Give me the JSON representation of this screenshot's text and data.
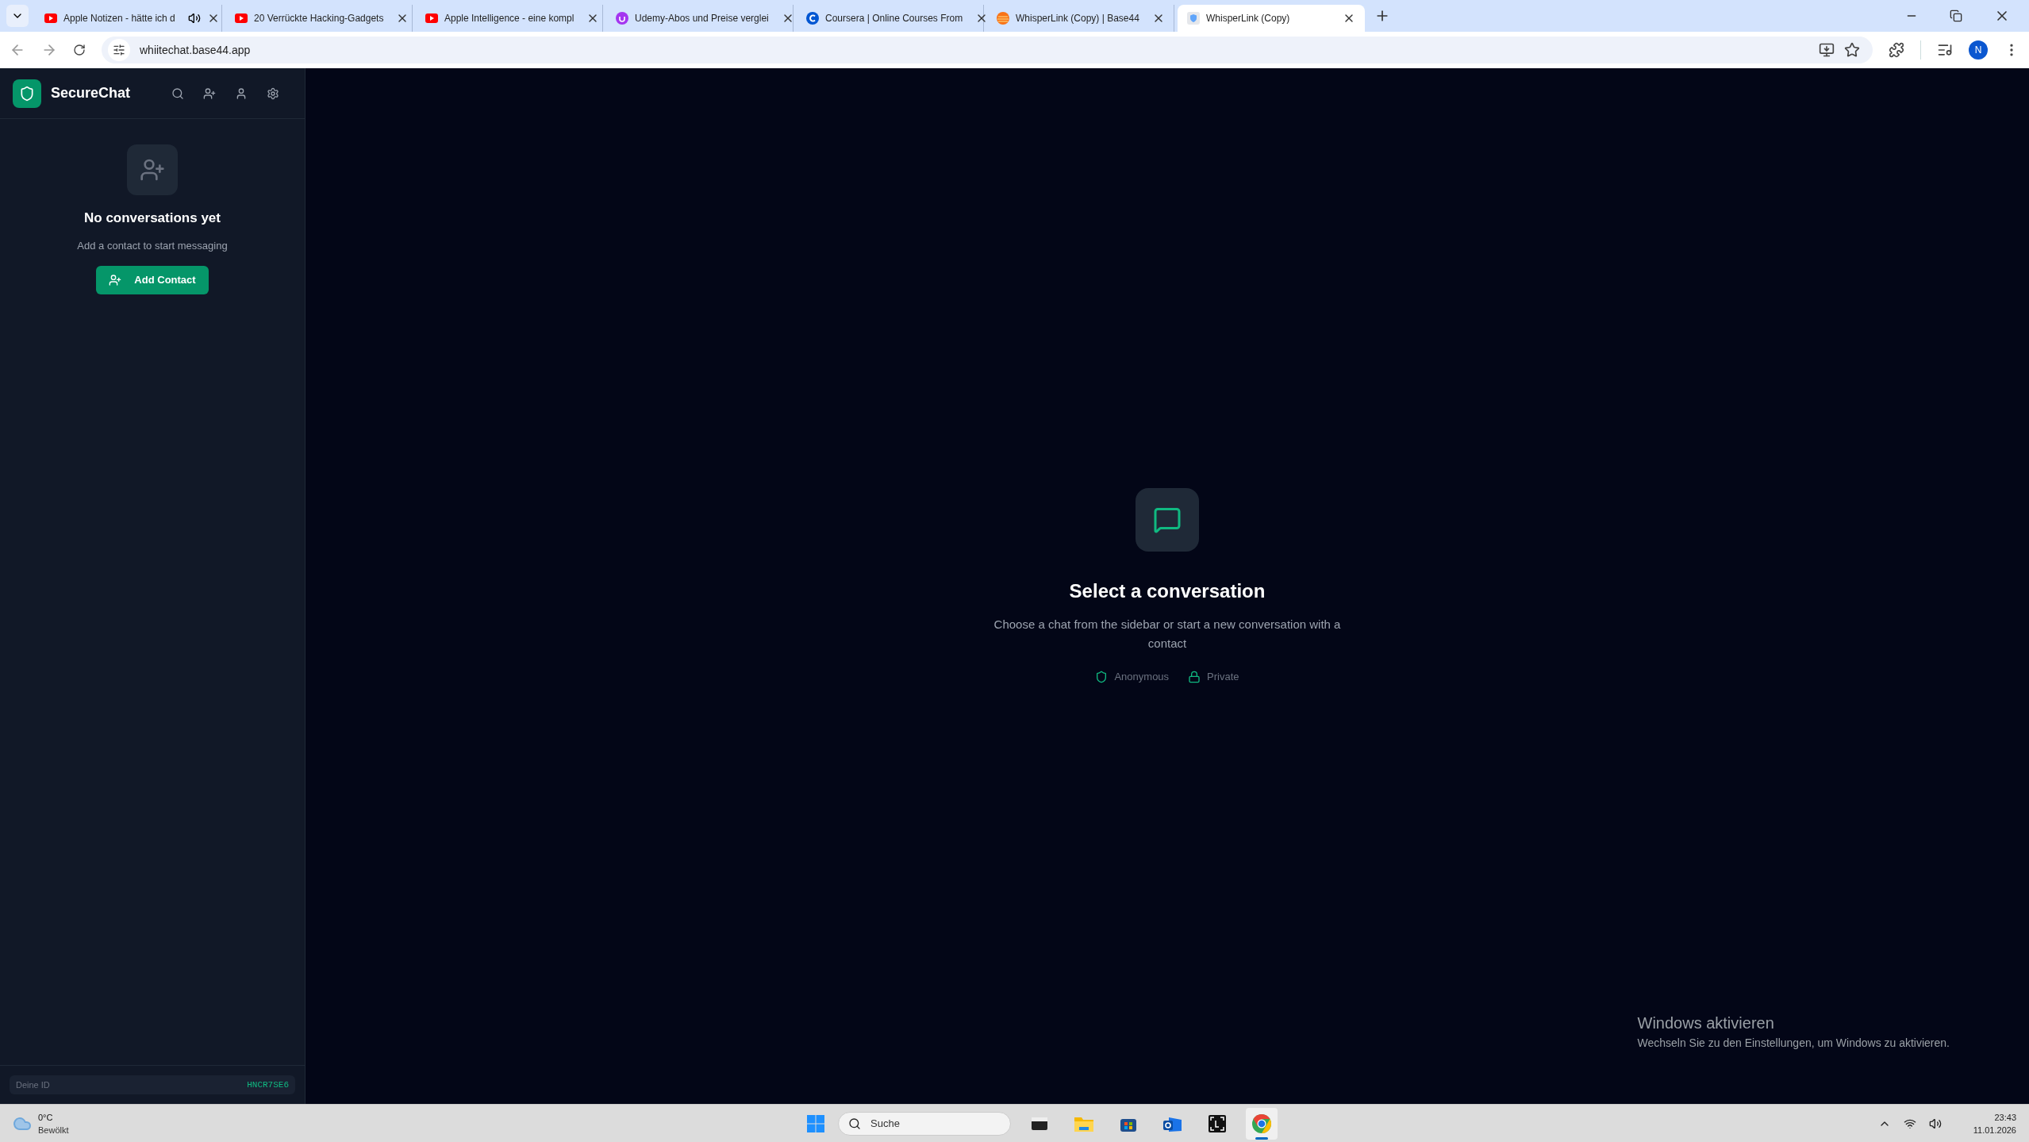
{
  "browser": {
    "tabs": [
      {
        "title": "Apple Notizen - hätte ich d",
        "kind": "youtube",
        "audio": true,
        "selected": false
      },
      {
        "title": "20 Verrückte Hacking-Gadgets",
        "kind": "youtube",
        "audio": false,
        "selected": false
      },
      {
        "title": "Apple Intelligence - eine kompl",
        "kind": "youtube",
        "audio": false,
        "selected": false
      },
      {
        "title": "Udemy-Abos und Preise verglei",
        "kind": "udemy",
        "audio": false,
        "selected": false
      },
      {
        "title": "Coursera | Online Courses From",
        "kind": "coursera",
        "audio": false,
        "selected": false
      },
      {
        "title": "WhisperLink (Copy) | Base44",
        "kind": "base44",
        "audio": false,
        "selected": false
      },
      {
        "title": "WhisperLink (Copy)",
        "kind": "shield",
        "audio": false,
        "selected": true
      }
    ],
    "address": "whiitechat.base44.app",
    "profile_initial": "N"
  },
  "sidebar": {
    "brand": "SecureChat",
    "empty_title": "No conversations yet",
    "empty_text": "Add a contact to start messaging",
    "add_button": "Add Contact",
    "id_label": "Deine ID",
    "id_value": "HNCR7SE6"
  },
  "main": {
    "title": "Select a conversation",
    "text": "Choose a chat from the sidebar or start a new conversation with a contact",
    "badges": [
      {
        "kind": "shield",
        "label": "Anonymous"
      },
      {
        "kind": "lock",
        "label": "Private"
      }
    ]
  },
  "activation": {
    "title": "Windows aktivieren",
    "text": "Wechseln Sie zu den Einstellungen, um Windows zu aktivieren."
  },
  "taskbar": {
    "temperature": "0°C",
    "weather": "Bewölkt",
    "search_placeholder": "Suche",
    "apps": [
      {
        "kind": "terminal",
        "selected": false
      },
      {
        "kind": "folder",
        "selected": false
      },
      {
        "kind": "store",
        "selected": false
      },
      {
        "kind": "outlook",
        "selected": false
      },
      {
        "kind": "lens",
        "selected": false
      },
      {
        "kind": "chrome",
        "selected": true
      }
    ],
    "time": "23:43",
    "date": "11.01.2026"
  }
}
